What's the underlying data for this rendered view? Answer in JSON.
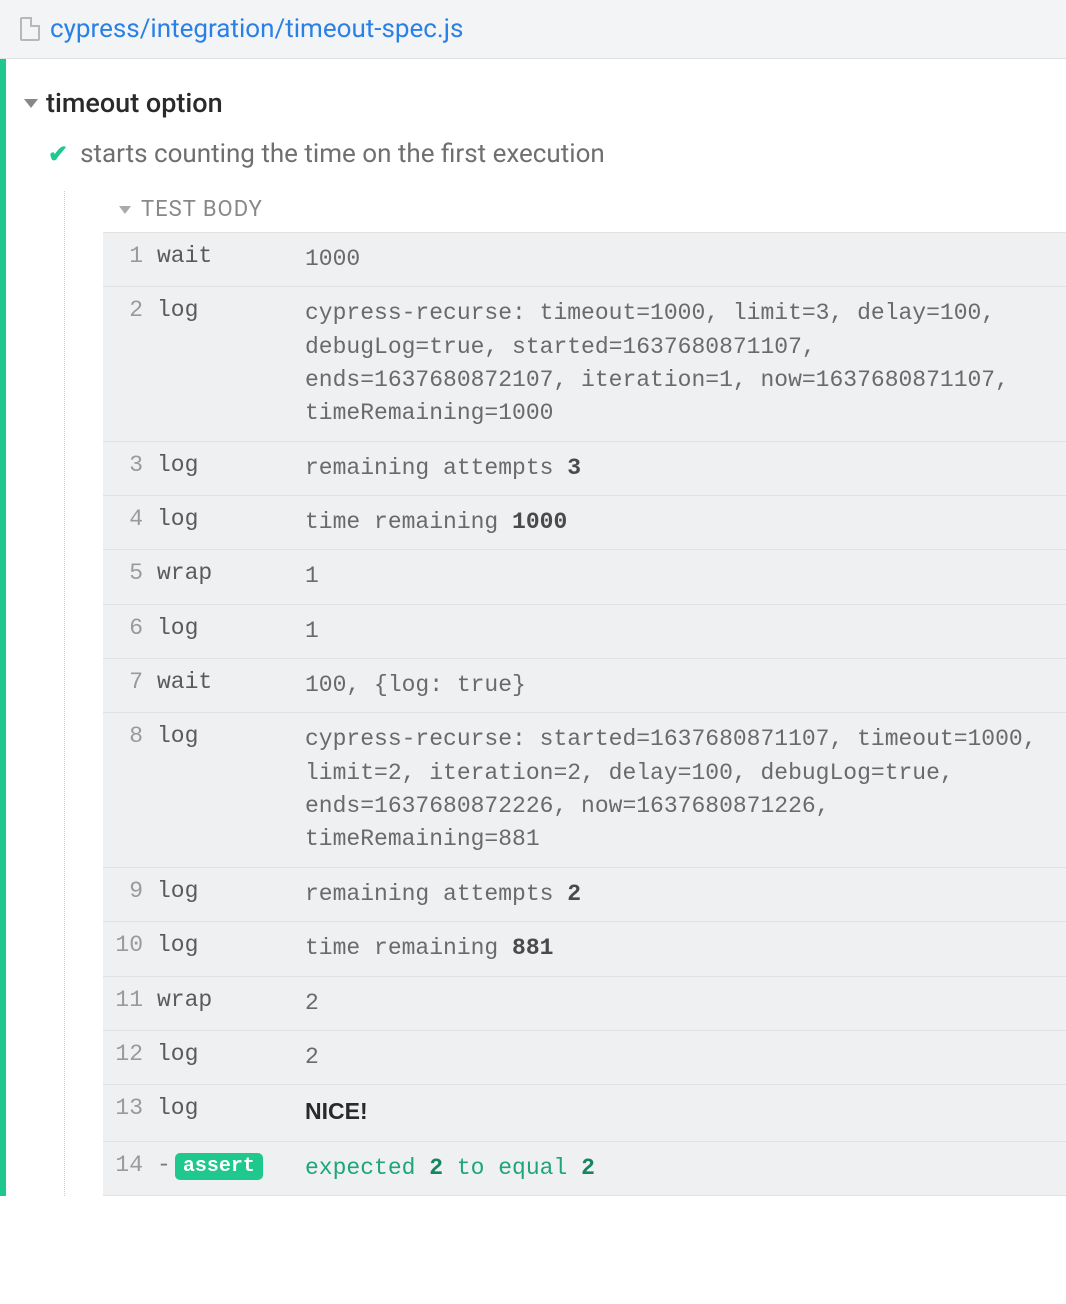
{
  "file_path": "cypress/integration/timeout-spec.js",
  "suite_title": "timeout option",
  "test_title": "starts counting the time on the first execution",
  "test_body_label": "TEST BODY",
  "commands": [
    {
      "num": "1",
      "name": "wait",
      "msg": [
        {
          "t": "1000"
        }
      ]
    },
    {
      "num": "2",
      "name": "log",
      "msg": [
        {
          "t": "cypress-recurse: timeout=1000, limit=3, delay=100, debugLog=true, started=1637680871107, ends=1637680872107, iteration=1, now=1637680871107, timeRemaining=1000"
        }
      ]
    },
    {
      "num": "3",
      "name": "log",
      "msg": [
        {
          "t": "remaining attempts "
        },
        {
          "t": "3",
          "b": true
        }
      ]
    },
    {
      "num": "4",
      "name": "log",
      "msg": [
        {
          "t": "time remaining "
        },
        {
          "t": "1000",
          "b": true
        }
      ]
    },
    {
      "num": "5",
      "name": "wrap",
      "msg": [
        {
          "t": "1"
        }
      ]
    },
    {
      "num": "6",
      "name": "log",
      "msg": [
        {
          "t": "1"
        }
      ]
    },
    {
      "num": "7",
      "name": "wait",
      "msg": [
        {
          "t": "100, {log: true}"
        }
      ]
    },
    {
      "num": "8",
      "name": "log",
      "msg": [
        {
          "t": "cypress-recurse: started=1637680871107, timeout=1000, limit=2, iteration=2, delay=100, debugLog=true, ends=1637680872226, now=1637680871226, timeRemaining=881"
        }
      ]
    },
    {
      "num": "9",
      "name": "log",
      "msg": [
        {
          "t": "remaining attempts "
        },
        {
          "t": "2",
          "b": true
        }
      ]
    },
    {
      "num": "10",
      "name": "log",
      "msg": [
        {
          "t": "time remaining "
        },
        {
          "t": "881",
          "b": true
        }
      ]
    },
    {
      "num": "11",
      "name": "wrap",
      "msg": [
        {
          "t": "2"
        }
      ]
    },
    {
      "num": "12",
      "name": "log",
      "msg": [
        {
          "t": "2"
        }
      ]
    },
    {
      "num": "13",
      "name": "log",
      "msg": [
        {
          "t": "NICE!",
          "nice": true
        }
      ]
    },
    {
      "num": "14",
      "name": "assert",
      "assert": true,
      "msg": [
        {
          "t": "expected "
        },
        {
          "t": "2",
          "b": true
        },
        {
          "t": " to equal "
        },
        {
          "t": "2",
          "b": true
        }
      ]
    }
  ]
}
